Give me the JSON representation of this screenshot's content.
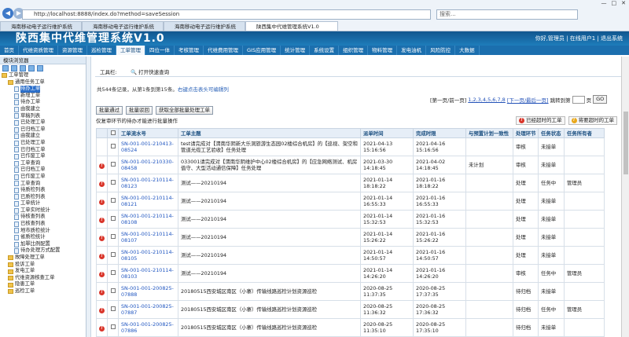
{
  "browser": {
    "url": "http://localhost:8888/index.do?method=saveSession",
    "search_placeholder": "搜索...",
    "tabs": [
      {
        "label": "海南移动电子运行维护系统",
        "active": false
      },
      {
        "label": "海南移动电子运行维护系统",
        "active": false
      },
      {
        "label": "海南移动电子运行维护系统",
        "active": false
      },
      {
        "label": "陕西集中代维管理系统V1.0",
        "active": true
      }
    ]
  },
  "app": {
    "title": "陕西集中代维管理系统V1.0",
    "user_text": "你好,管理员 | 在线用户1 | 退出系统",
    "menu": [
      "首页",
      "代维资质管理",
      "资源管理",
      "巡检管理",
      "工单管理",
      "四位一体",
      "考核管理",
      "代维费用管理",
      "GIS应用管理",
      "统计管理",
      "系统设置",
      "组织管理",
      "物料管理",
      "发电油机",
      "风险防控",
      "大数据"
    ],
    "menu_active": 4
  },
  "sidebar": {
    "header": "模块浏览器",
    "tree": [
      {
        "level": 0,
        "type": "fold",
        "label": "工单管理"
      },
      {
        "level": 1,
        "type": "fold",
        "label": "通用任务工单"
      },
      {
        "level": 2,
        "type": "file",
        "label": "待办工单",
        "selected": true
      },
      {
        "level": 2,
        "type": "file",
        "label": "新增工单"
      },
      {
        "level": 2,
        "type": "file",
        "label": "待办工单"
      },
      {
        "level": 2,
        "type": "file",
        "label": "由我建立"
      },
      {
        "level": 2,
        "type": "file",
        "label": "草稿列表"
      },
      {
        "level": 2,
        "type": "file",
        "label": "已处理工单"
      },
      {
        "level": 2,
        "type": "file",
        "label": "已归档工单"
      },
      {
        "level": 2,
        "type": "file",
        "label": "由我建立"
      },
      {
        "level": 2,
        "type": "file",
        "label": "已处理工单"
      },
      {
        "level": 2,
        "type": "file",
        "label": "已归档工单"
      },
      {
        "level": 2,
        "type": "file",
        "label": "已作废工单"
      },
      {
        "level": 2,
        "type": "file",
        "label": "工单查询"
      },
      {
        "level": 2,
        "type": "file",
        "label": "已归档工单"
      },
      {
        "level": 2,
        "type": "file",
        "label": "已作废工单"
      },
      {
        "level": 2,
        "type": "file",
        "label": "工单查询"
      },
      {
        "level": 2,
        "type": "file",
        "label": "待质检列表"
      },
      {
        "level": 2,
        "type": "file",
        "label": "已质检列表"
      },
      {
        "level": 2,
        "type": "file",
        "label": "工单统计"
      },
      {
        "level": 2,
        "type": "file",
        "label": "工单实时统计"
      },
      {
        "level": 2,
        "type": "file",
        "label": "待核查列表"
      },
      {
        "level": 2,
        "type": "file",
        "label": "已核查列表"
      },
      {
        "level": 2,
        "type": "file",
        "label": "地市质检统计"
      },
      {
        "level": 2,
        "type": "file",
        "label": "省质检统计"
      },
      {
        "level": 2,
        "type": "file",
        "label": "加單比例配置"
      },
      {
        "level": 2,
        "type": "file",
        "label": "待办处理方式配置"
      },
      {
        "level": 1,
        "type": "fold",
        "label": "故障处理工单"
      },
      {
        "level": 1,
        "type": "fold",
        "label": "投诉工单"
      },
      {
        "level": 1,
        "type": "fold",
        "label": "发电工单"
      },
      {
        "level": 1,
        "type": "fold",
        "label": "代维资源核查工单"
      },
      {
        "level": 1,
        "type": "fold",
        "label": "隐患工单"
      },
      {
        "level": 1,
        "type": "fold",
        "label": "巡检工单"
      }
    ]
  },
  "content": {
    "toolbar_label": "工具栏:",
    "quick_query": "打开快速查询",
    "summary": "共544条记录，从第1条到第15条。",
    "summary_hint": "右键点击表头可编辑列",
    "pager": {
      "prefix": "[第一页/前一页]",
      "pages": "1,2,3,4,5,6,7,8",
      "next": "[下一页/最后一页]",
      "jump": "跳转到第",
      "unit": "页",
      "go": "GO"
    },
    "buttons": [
      "批量通过",
      "批量驳回",
      "获取全部批量处理工单"
    ],
    "note": "仅复审环节的待办才能进行批量操作",
    "legend": [
      "已经超时的工单",
      "将要超时的工单"
    ],
    "columns": [
      "",
      "",
      "工单流水号",
      "工单主题",
      "派单时间",
      "完成时限",
      "与预置计划一致性",
      "处理环节",
      "任务状态",
      "任务所有者"
    ],
    "rows": [
      {
        "icon": false,
        "sn": "SN-001-001-210413-08524",
        "subject": "test请完成对【渭南华阴新大乐洞旅游生态园02楼综合机房】的【巡视、架空和管道光缆工艺验收】任务处理",
        "send": "2021-04-13 15:16:56",
        "due": "2021-04-16 15:16:56",
        "plan": "",
        "step": "审核",
        "status": "未接单",
        "owner": ""
      },
      {
        "icon": true,
        "sn": "SN-001-001-210330-08458",
        "subject": "033001请完成对【渭南华阴维护中心02楼综合机房】的【应急网络测试、机房值守、大型活动通信保障】任务处理",
        "send": "2021-03-30 14:18:45",
        "due": "2021-04-02 14:18:45",
        "plan": "未计划",
        "step": "审核",
        "status": "未接单",
        "owner": ""
      },
      {
        "icon": true,
        "sn": "SN-001-001-210114-08123",
        "subject": "测试——20210194",
        "send": "2021-01-14 18:18:22",
        "due": "2021-01-16 18:18:22",
        "plan": "",
        "step": "处理",
        "status": "任务中",
        "owner": "管理员"
      },
      {
        "icon": true,
        "sn": "SN-001-001-210114-08121",
        "subject": "测试——20210194",
        "send": "2021-01-14 16:55:33",
        "due": "2021-01-16 16:55:33",
        "plan": "",
        "step": "处理",
        "status": "未接单",
        "owner": ""
      },
      {
        "icon": true,
        "sn": "SN-001-001-210114-08108",
        "subject": "测试——20210194",
        "send": "2021-01-14 15:32:53",
        "due": "2021-01-16 15:32:53",
        "plan": "",
        "step": "处理",
        "status": "未接单",
        "owner": ""
      },
      {
        "icon": true,
        "sn": "SN-001-001-210114-08107",
        "subject": "测试——20210194",
        "send": "2021-01-14 15:26:22",
        "due": "2021-01-16 15:26:22",
        "plan": "",
        "step": "处理",
        "status": "未接单",
        "owner": ""
      },
      {
        "icon": true,
        "sn": "SN-001-001-210114-08105",
        "subject": "测试——20210194",
        "send": "2021-01-14 14:50:57",
        "due": "2021-01-16 14:50:57",
        "plan": "",
        "step": "处理",
        "status": "未接单",
        "owner": ""
      },
      {
        "icon": true,
        "sn": "SN-001-001-210114-08103",
        "subject": "测试——20210194",
        "send": "2021-01-14 14:26:20",
        "due": "2021-01-16 14:26:20",
        "plan": "",
        "step": "审核",
        "status": "任务中",
        "owner": "管理员"
      },
      {
        "icon": true,
        "sn": "SN-001-001-200825-07888",
        "subject": "20180515西安城区南区（小寨）传输线路巡检计划资源巡检",
        "send": "2020-08-25 11:37:35",
        "due": "2020-08-25 17:37:35",
        "plan": "",
        "step": "待归档",
        "status": "未接单",
        "owner": ""
      },
      {
        "icon": true,
        "sn": "SN-001-001-200825-07887",
        "subject": "20180515西安城区南区（小寨）传输线路巡检计划资源巡检",
        "send": "2020-08-25 11:36:32",
        "due": "2020-08-25 17:36:32",
        "plan": "",
        "step": "待归档",
        "status": "任务中",
        "owner": "管理员"
      },
      {
        "icon": true,
        "sn": "SN-001-001-200825-07886",
        "subject": "20180515西安城区南区（小寨）传输线路巡检计划资源巡检",
        "send": "2020-08-25 11:35:10",
        "due": "2020-08-25 17:35:10",
        "plan": "",
        "step": "待归档",
        "status": "未接单",
        "owner": ""
      }
    ]
  }
}
